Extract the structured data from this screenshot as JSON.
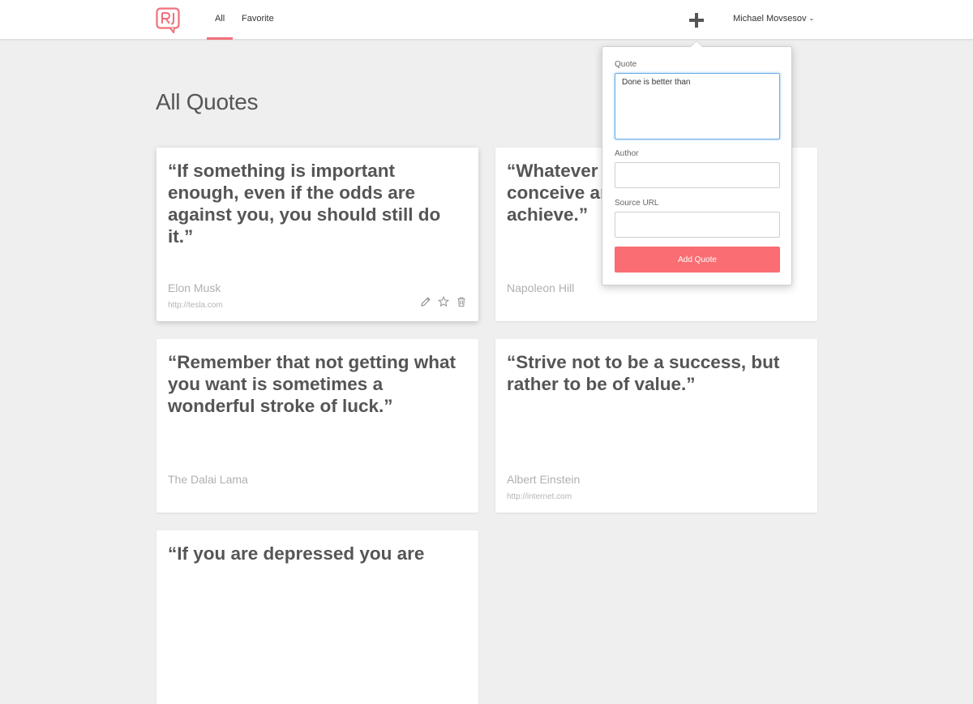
{
  "nav": {
    "tabs": [
      {
        "label": "All",
        "active": true
      },
      {
        "label": "Favorite",
        "active": false
      }
    ],
    "user": "Michael Movsesov",
    "logo_icon": "speech-bubble-logo",
    "accent": "#f0707a"
  },
  "main": {
    "title": "All Quotes",
    "quotes": [
      {
        "text": "“If something is important enough, even if the odds are against you, you should still do it.”",
        "author": "Elon Musk",
        "source": "http://tesla.com"
      },
      {
        "text": "“Whatever the mind of man can conceive and believe, it can achieve.”",
        "author": "Napoleon Hill",
        "source": ""
      },
      {
        "text": "“Remember that not getting what you want is sometimes a wonderful stroke of luck.”",
        "author": "The Dalai Lama",
        "source": ""
      },
      {
        "text": "“Strive not to be a success, but rather to be of value.”",
        "author": "Albert Einstein",
        "source": "http://internet.com"
      },
      {
        "text": "“If you are depressed you are",
        "author": "",
        "source": ""
      }
    ],
    "card_actions": [
      "pencil-icon",
      "star-icon",
      "trash-icon"
    ]
  },
  "popover": {
    "quote_label": "Quote",
    "quote_value": "Done is better than",
    "author_label": "Author",
    "author_value": "",
    "source_label": "Source URL",
    "source_value": "",
    "submit_label": "Add Quote",
    "button_color": "#f96d73"
  }
}
